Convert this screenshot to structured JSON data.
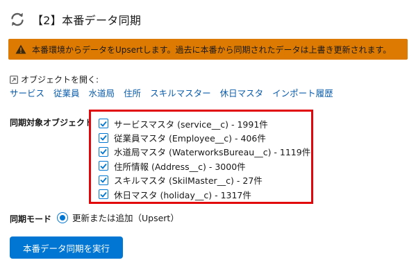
{
  "header": {
    "icon": "sync-icon",
    "title": "【2】本番データ同期"
  },
  "banner": {
    "icon": "warning-icon",
    "color": "#dd7a01",
    "message": "本番環境からデータをUpsertします。過去に本番から同期されたデータは上書き更新されます。"
  },
  "open_objects": {
    "icon": "open-external-icon",
    "label": "オブジェクトを開く:",
    "links": [
      "サービス",
      "従業員",
      "水道局",
      "住所",
      "スキルマスター",
      "休日マスタ",
      "インポート履歴"
    ]
  },
  "sync_targets": {
    "label": "同期対象オブジェクト",
    "highlight_color": "#e0060a",
    "items": [
      {
        "text": "サービスマスタ (service__c) - 1991件",
        "checked": true
      },
      {
        "text": "従業員マスタ (Employee__c) - 406件",
        "checked": true
      },
      {
        "text": "水道局マスタ (WaterworksBureau__c) - 1119件",
        "checked": true
      },
      {
        "text": "住所情報 (Address__c) - 3000件",
        "checked": true
      },
      {
        "text": "スキルマスタ (SkilMaster__c) - 27件",
        "checked": true
      },
      {
        "text": "休日マスタ (holiday__c) - 1317件",
        "checked": true
      }
    ]
  },
  "sync_mode": {
    "label": "同期モード",
    "option": "更新または追加（Upsert）",
    "selected": true
  },
  "run_button": {
    "label": "本番データ同期を実行",
    "color": "#0176d3"
  }
}
